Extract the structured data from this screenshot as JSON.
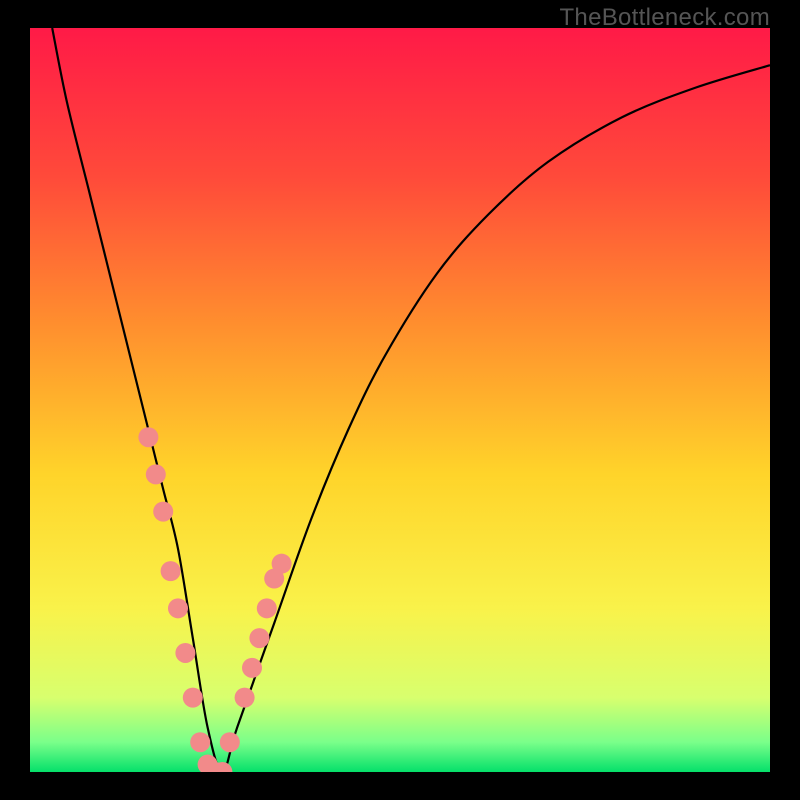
{
  "watermark": "TheBottleneck.com",
  "chart_data": {
    "type": "line",
    "title": "",
    "xlabel": "",
    "ylabel": "",
    "xlim": [
      0,
      100
    ],
    "ylim": [
      0,
      100
    ],
    "grid": false,
    "background_gradient": {
      "stops": [
        {
          "pos": 0.0,
          "color": "#ff1a47"
        },
        {
          "pos": 0.2,
          "color": "#ff4a3a"
        },
        {
          "pos": 0.4,
          "color": "#ff8f2e"
        },
        {
          "pos": 0.6,
          "color": "#ffd42a"
        },
        {
          "pos": 0.78,
          "color": "#f9f24a"
        },
        {
          "pos": 0.9,
          "color": "#d8ff6e"
        },
        {
          "pos": 0.96,
          "color": "#7aff8a"
        },
        {
          "pos": 1.0,
          "color": "#05e06a"
        }
      ]
    },
    "series": [
      {
        "name": "bottleneck-curve",
        "stroke": "#000000",
        "x": [
          3,
          5,
          8,
          10,
          12,
          14,
          16,
          18,
          20,
          22,
          24,
          26,
          28,
          33,
          38,
          43,
          48,
          55,
          62,
          70,
          80,
          90,
          100
        ],
        "values": [
          100,
          90,
          78,
          70,
          62,
          54,
          46,
          38,
          30,
          18,
          6,
          0,
          6,
          20,
          34,
          46,
          56,
          67,
          75,
          82,
          88,
          92,
          95
        ]
      }
    ],
    "markers": {
      "name": "highlight-dots",
      "color": "#f28a8a",
      "radius": 10,
      "x": [
        16,
        17,
        18,
        19,
        20,
        21,
        22,
        23,
        24,
        25,
        26,
        27,
        29,
        30,
        31,
        32,
        33,
        34
      ],
      "values": [
        45,
        40,
        35,
        27,
        22,
        16,
        10,
        4,
        1,
        0,
        0,
        4,
        10,
        14,
        18,
        22,
        26,
        28
      ]
    }
  }
}
